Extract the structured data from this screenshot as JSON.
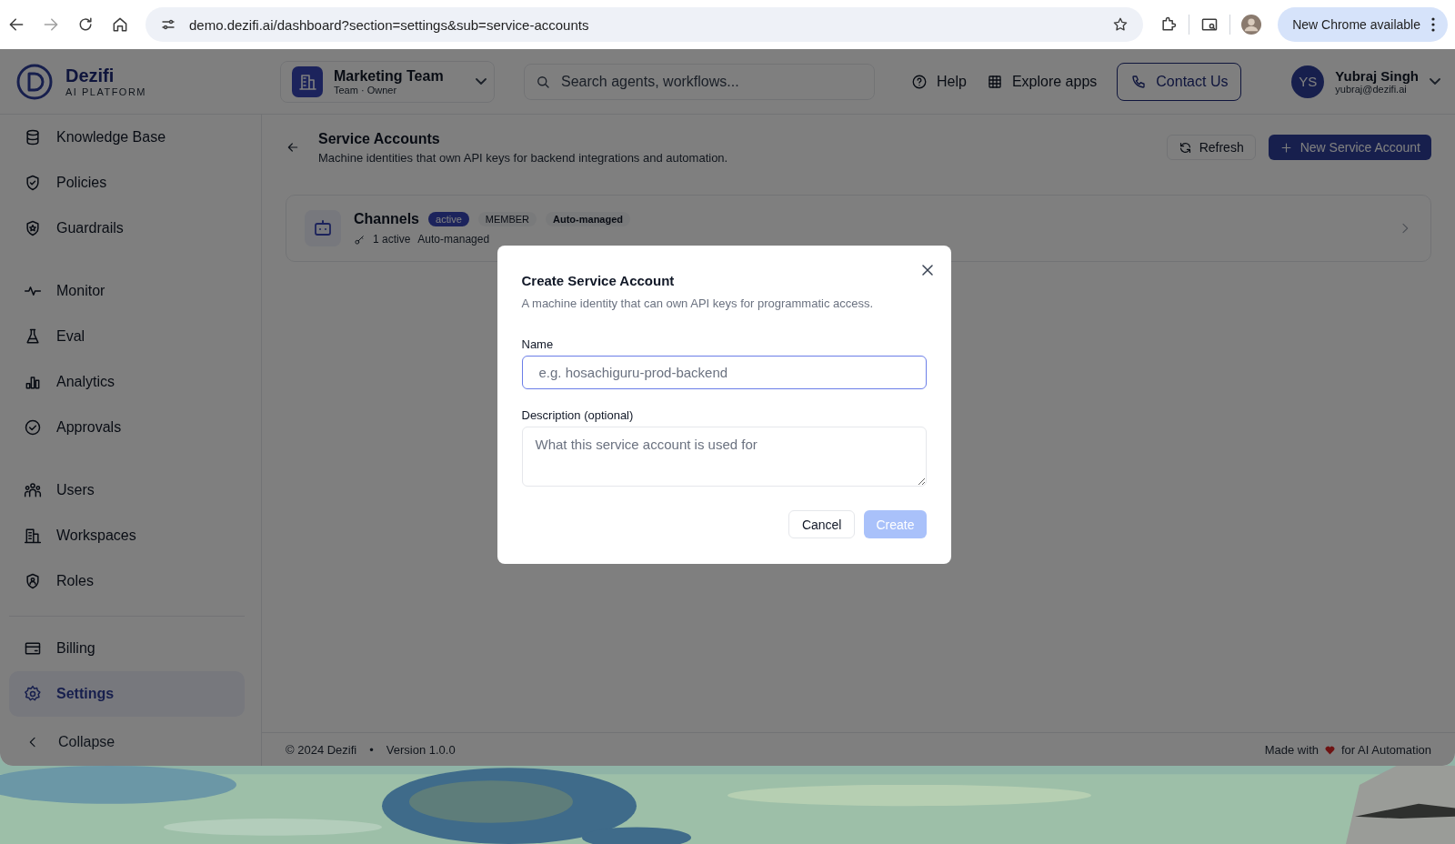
{
  "browser": {
    "url": "demo.dezifi.ai/dashboard?section=settings&sub=service-accounts",
    "update_button": "New Chrome available"
  },
  "brand": {
    "name": "Dezifi",
    "subtitle": "AI PLATFORM"
  },
  "team": {
    "name": "Marketing Team",
    "role": "Team · Owner"
  },
  "search": {
    "placeholder": "Search agents, workflows..."
  },
  "header_links": [
    "Help",
    "Explore apps"
  ],
  "contact_button": "Contact Us",
  "user": {
    "initials": "YS",
    "name": "Yubraj Singh",
    "email": "yubraj@dezifi.ai"
  },
  "sidebar": {
    "groups": [
      {
        "items": [
          {
            "label": "Knowledge Base",
            "selected": false
          },
          {
            "label": "Policies",
            "selected": false
          },
          {
            "label": "Guardrails",
            "selected": false
          }
        ]
      },
      {
        "items": [
          {
            "label": "Monitor",
            "selected": false
          },
          {
            "label": "Eval",
            "selected": false
          },
          {
            "label": "Analytics",
            "selected": false
          },
          {
            "label": "Approvals",
            "selected": false
          }
        ]
      },
      {
        "items": [
          {
            "label": "Users",
            "selected": false
          },
          {
            "label": "Workspaces",
            "selected": false
          },
          {
            "label": "Roles",
            "selected": false
          }
        ]
      },
      {
        "items": [
          {
            "label": "Billing",
            "selected": false
          },
          {
            "label": "Settings",
            "selected": true
          }
        ]
      }
    ],
    "collapse": "Collapse"
  },
  "page": {
    "title": "Service Accounts",
    "subtitle": "Machine identities that own API keys for backend integrations and automation.",
    "refresh_button": "Refresh",
    "new_button": "New Service Account"
  },
  "service_accounts": [
    {
      "name": "Channels",
      "badges": [
        {
          "kind": "status",
          "text": "active"
        },
        {
          "kind": "role",
          "text": "MEMBER"
        },
        {
          "kind": "tag",
          "text": "Auto-managed"
        }
      ],
      "keys": "1 active",
      "detail": "Auto-managed"
    }
  ],
  "footer": {
    "copyright": "© 2024 Dezifi",
    "separator": "•",
    "version": "Version 1.0.0",
    "made_with": "Made with",
    "tagline": "for AI Automation"
  },
  "modal": {
    "title": "Create Service Account",
    "description": "A machine identity that can own API keys for programmatic access.",
    "fields": [
      {
        "kind": "input",
        "label": "Name",
        "placeholder": "e.g. hosachiguru-prod-backend",
        "focused": true
      },
      {
        "kind": "textarea",
        "label": "Description (optional)",
        "placeholder": "What this service account is used for",
        "focused": false
      }
    ],
    "cancel_button": "Cancel",
    "create_button": {
      "label": "Create",
      "disabled": true
    }
  }
}
